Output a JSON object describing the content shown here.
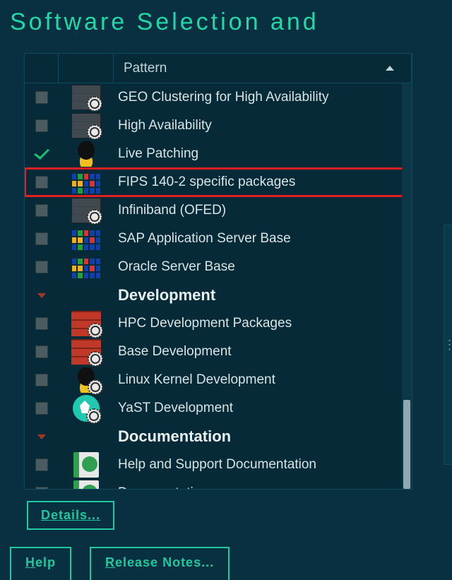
{
  "title": "Software Selection and",
  "header": {
    "pattern_label": "Pattern"
  },
  "rows": [
    {
      "type": "item",
      "checked": false,
      "icon": "server",
      "gear": true,
      "label": "GEO Clustering for High Availability"
    },
    {
      "type": "item",
      "checked": false,
      "icon": "server",
      "gear": true,
      "label": "High Availability"
    },
    {
      "type": "item",
      "checked": true,
      "icon": "tux",
      "gear": false,
      "label": "Live Patching"
    },
    {
      "type": "item",
      "checked": false,
      "icon": "pixels",
      "gear": false,
      "label": "FIPS 140-2 specific packages",
      "highlight": true
    },
    {
      "type": "item",
      "checked": false,
      "icon": "server",
      "gear": true,
      "label": "Infiniband (OFED)"
    },
    {
      "type": "item",
      "checked": false,
      "icon": "pixels",
      "gear": false,
      "label": "SAP Application Server Base"
    },
    {
      "type": "item",
      "checked": false,
      "icon": "pixels",
      "gear": false,
      "label": "Oracle Server Base"
    },
    {
      "type": "section",
      "label": "Development"
    },
    {
      "type": "item",
      "checked": false,
      "icon": "bricks",
      "gear": true,
      "label": "HPC Development Packages"
    },
    {
      "type": "item",
      "checked": false,
      "icon": "bricks",
      "gear": true,
      "label": "Base Development"
    },
    {
      "type": "item",
      "checked": false,
      "icon": "tux",
      "gear": true,
      "label": "Linux Kernel Development"
    },
    {
      "type": "item",
      "checked": false,
      "icon": "circle",
      "gear": true,
      "label": "YaST Development"
    },
    {
      "type": "section",
      "label": "Documentation"
    },
    {
      "type": "item",
      "checked": false,
      "icon": "book",
      "gear": false,
      "label": "Help and Support Documentation"
    },
    {
      "type": "item",
      "checked": false,
      "icon": "book",
      "gear": false,
      "label": "Documentation"
    }
  ],
  "scrollbar": {
    "thumb_top_pct": 78,
    "thumb_height_pct": 22
  },
  "buttons": {
    "details": "Details...",
    "help_underline": "H",
    "help_rest": "elp",
    "release_underline": "R",
    "release_rest": "elease Notes..."
  }
}
